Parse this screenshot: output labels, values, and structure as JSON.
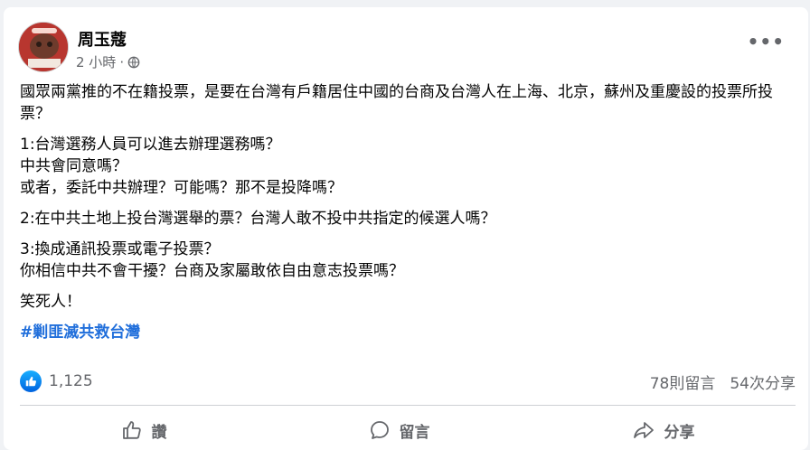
{
  "post": {
    "author": "周玉蔻",
    "time": "2 小時",
    "separator": "·",
    "paragraphs": [
      "國眾兩黨推的不在籍投票，是要在台灣有戶籍居住中國的台商及台灣人在上海、北京，蘇州及重慶設的投票所投票？",
      "1:台灣選務人員可以進去辦理選務嗎？\n中共會同意嗎？\n或者，委託中共辦理？可能嗎？那不是投降嗎？",
      "2:在中共土地上投台灣選舉的票？台灣人敢不投中共指定的候選人嗎？",
      "3:換成通訊投票或電子投票？\n你相信中共不會干擾？台商及家屬敢依自由意志投票嗎？",
      "笑死人！"
    ],
    "hashtag": "#剿匪滅共救台灣",
    "likes": "1,125",
    "comments": "78則留言",
    "shares": "54次分享"
  },
  "actions": {
    "like": "讚",
    "comment": "留言",
    "share": "分享"
  },
  "icons": [
    "globe-icon",
    "more-icon",
    "like-icon",
    "comment-icon",
    "share-icon"
  ],
  "colors": {
    "accent": "#216fdb",
    "like": "#0866ff",
    "muted": "#65676b"
  }
}
